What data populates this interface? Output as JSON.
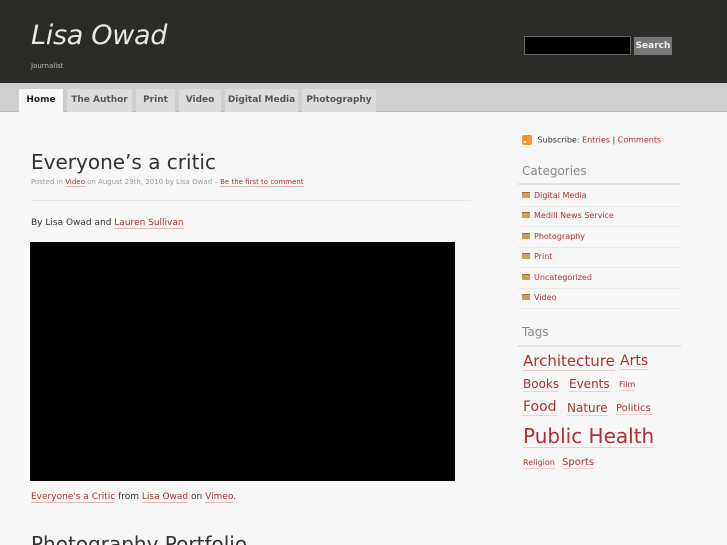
{
  "site": {
    "title": "Lisa Owad",
    "tagline": "Journalist"
  },
  "search": {
    "placeholder": "",
    "button_label": "Search"
  },
  "nav": {
    "tabs": [
      "Home",
      "The Author",
      "Print",
      "Video",
      "Digital Media",
      "Photography"
    ],
    "active": "Home"
  },
  "post": {
    "title": "Everyone’s a critic",
    "meta": {
      "posted_in": "Posted in",
      "category": "Video",
      "date_by": "on August 29th, 2010 by Lisa Owad –",
      "comment_link": "Be the first to comment"
    },
    "byline": {
      "prefix": "By Lisa Owad and",
      "coauthor": "Lauren Sullivan"
    },
    "video_credit": {
      "title": "Everyone's a Critic",
      "from": "from",
      "author": "Lisa Owad",
      "on": "on",
      "site": "Vimeo",
      "end": "."
    }
  },
  "next_post": {
    "title": "Photography Portfolio"
  },
  "sidebar": {
    "subscribe": {
      "label": "Subscribe:",
      "entries": "Entries",
      "sep": "|",
      "comments": "Comments"
    },
    "categories": {
      "heading": "Categories",
      "items": [
        "Digital Media",
        "Medill News Service",
        "Photography",
        "Print",
        "Uncategorized",
        "Video"
      ]
    },
    "tags": {
      "heading": "Tags",
      "items": [
        "Architecture",
        "Arts",
        "Books",
        "Events",
        "Film",
        "Food",
        "Nature",
        "Politics",
        "Public Health",
        "Religion",
        "Sports"
      ]
    }
  },
  "colors": {
    "header_bg": "#2b2b27",
    "link": "#b03030",
    "page_bg": "#f7f7f7"
  }
}
